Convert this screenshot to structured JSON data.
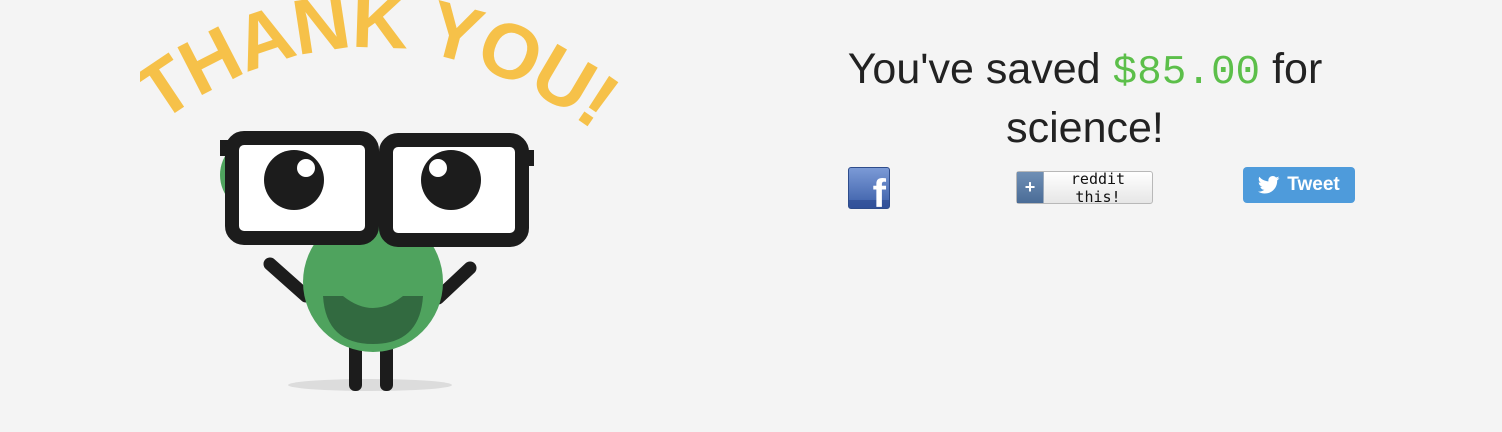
{
  "illustration": {
    "banner_text": "THANK YOU!",
    "colors": {
      "banner": "#f6c149",
      "body": "#4fa35e",
      "mouth": "#326a40",
      "frames": "#1c1c1c"
    }
  },
  "headline": {
    "prefix": "You've saved",
    "amount": "$85.00",
    "suffix_line1": "for",
    "suffix_line2": "science!",
    "amount_color": "#5cbf4a"
  },
  "share": {
    "facebook": {
      "glyph": "f",
      "icon": "facebook-icon"
    },
    "reddit": {
      "plus": "+",
      "label": "reddit this!"
    },
    "twitter": {
      "label": "Tweet",
      "icon": "twitter-bird-icon"
    }
  }
}
